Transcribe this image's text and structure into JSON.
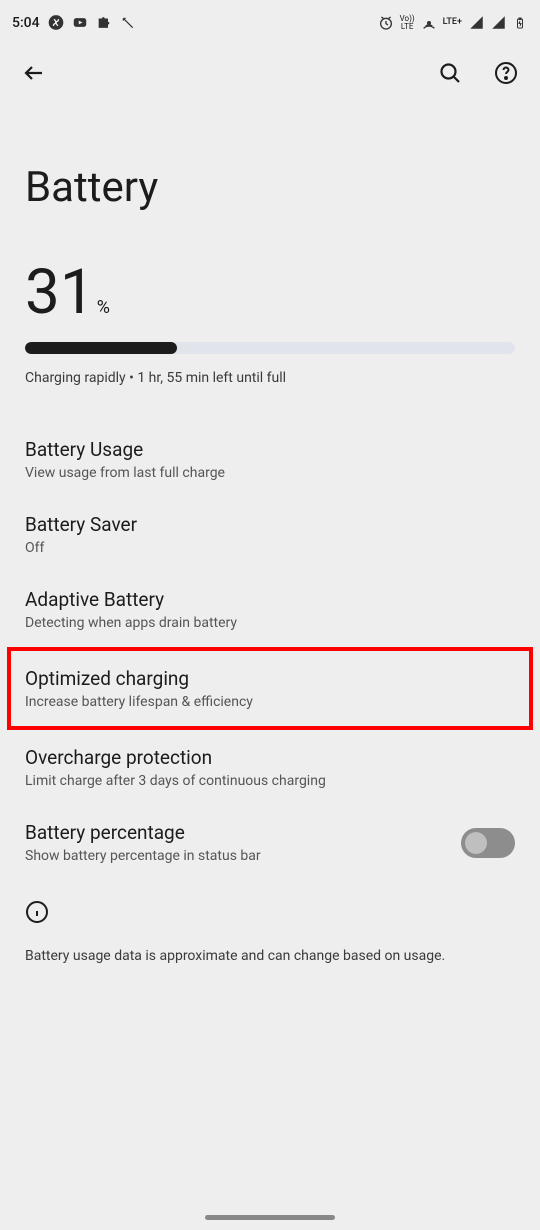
{
  "status": {
    "time": "5:04",
    "lte_text": "LTE+",
    "volte_text": "Vo))\nLTE"
  },
  "page": {
    "title": "Battery"
  },
  "battery": {
    "level": "31",
    "percent_sign": "%",
    "fill_width": "31%",
    "status_text": "Charging rapidly • 1 hr, 55 min left until full"
  },
  "items": [
    {
      "title": "Battery Usage",
      "sub": "View usage from last full charge"
    },
    {
      "title": "Battery Saver",
      "sub": "Off"
    },
    {
      "title": "Adaptive Battery",
      "sub": "Detecting when apps drain battery"
    },
    {
      "title": "Optimized charging",
      "sub": "Increase battery lifespan & efficiency"
    },
    {
      "title": "Overcharge protection",
      "sub": "Limit charge after 3 days of continuous charging"
    },
    {
      "title": "Battery percentage",
      "sub": "Show battery percentage in status bar"
    }
  ],
  "footer": {
    "info_text": "Battery usage data is approximate and can change based on usage."
  }
}
